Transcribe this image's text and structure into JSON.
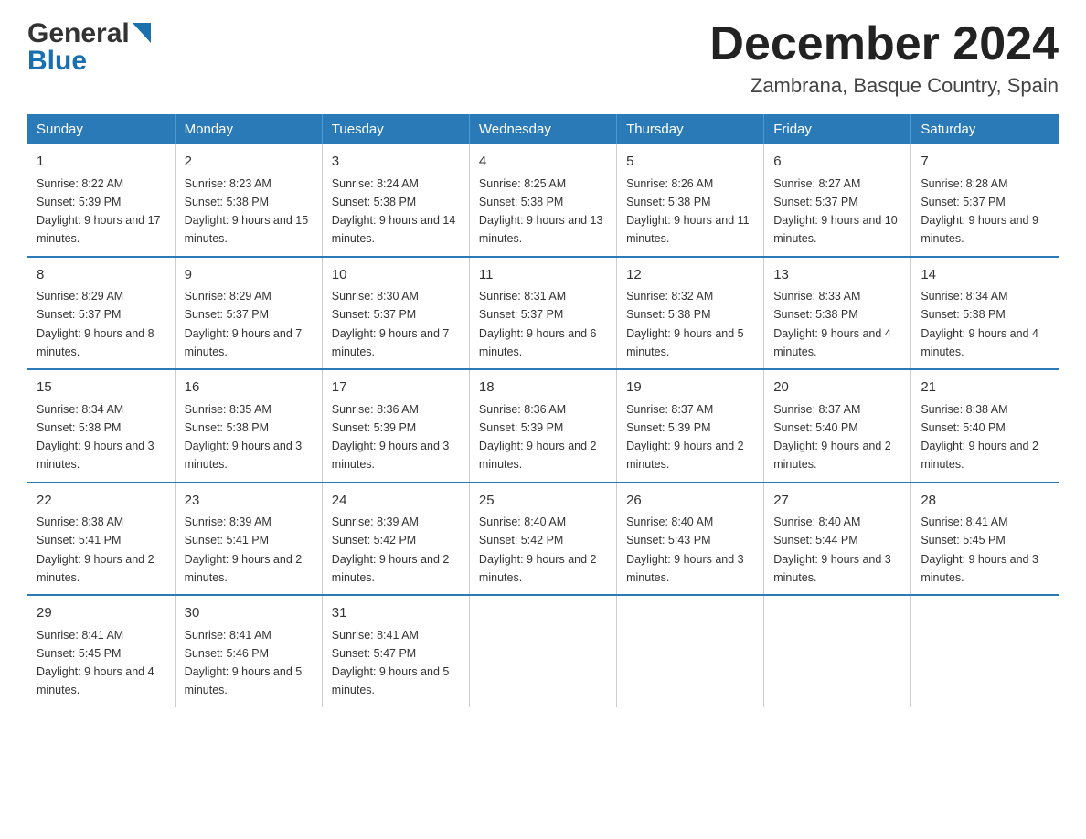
{
  "header": {
    "logo_general": "General",
    "logo_blue": "Blue",
    "title": "December 2024",
    "subtitle": "Zambrana, Basque Country, Spain"
  },
  "calendar": {
    "days_of_week": [
      "Sunday",
      "Monday",
      "Tuesday",
      "Wednesday",
      "Thursday",
      "Friday",
      "Saturday"
    ],
    "weeks": [
      [
        {
          "day": "1",
          "sunrise": "8:22 AM",
          "sunset": "5:39 PM",
          "daylight": "9 hours and 17 minutes."
        },
        {
          "day": "2",
          "sunrise": "8:23 AM",
          "sunset": "5:38 PM",
          "daylight": "9 hours and 15 minutes."
        },
        {
          "day": "3",
          "sunrise": "8:24 AM",
          "sunset": "5:38 PM",
          "daylight": "9 hours and 14 minutes."
        },
        {
          "day": "4",
          "sunrise": "8:25 AM",
          "sunset": "5:38 PM",
          "daylight": "9 hours and 13 minutes."
        },
        {
          "day": "5",
          "sunrise": "8:26 AM",
          "sunset": "5:38 PM",
          "daylight": "9 hours and 11 minutes."
        },
        {
          "day": "6",
          "sunrise": "8:27 AM",
          "sunset": "5:37 PM",
          "daylight": "9 hours and 10 minutes."
        },
        {
          "day": "7",
          "sunrise": "8:28 AM",
          "sunset": "5:37 PM",
          "daylight": "9 hours and 9 minutes."
        }
      ],
      [
        {
          "day": "8",
          "sunrise": "8:29 AM",
          "sunset": "5:37 PM",
          "daylight": "9 hours and 8 minutes."
        },
        {
          "day": "9",
          "sunrise": "8:29 AM",
          "sunset": "5:37 PM",
          "daylight": "9 hours and 7 minutes."
        },
        {
          "day": "10",
          "sunrise": "8:30 AM",
          "sunset": "5:37 PM",
          "daylight": "9 hours and 7 minutes."
        },
        {
          "day": "11",
          "sunrise": "8:31 AM",
          "sunset": "5:37 PM",
          "daylight": "9 hours and 6 minutes."
        },
        {
          "day": "12",
          "sunrise": "8:32 AM",
          "sunset": "5:38 PM",
          "daylight": "9 hours and 5 minutes."
        },
        {
          "day": "13",
          "sunrise": "8:33 AM",
          "sunset": "5:38 PM",
          "daylight": "9 hours and 4 minutes."
        },
        {
          "day": "14",
          "sunrise": "8:34 AM",
          "sunset": "5:38 PM",
          "daylight": "9 hours and 4 minutes."
        }
      ],
      [
        {
          "day": "15",
          "sunrise": "8:34 AM",
          "sunset": "5:38 PM",
          "daylight": "9 hours and 3 minutes."
        },
        {
          "day": "16",
          "sunrise": "8:35 AM",
          "sunset": "5:38 PM",
          "daylight": "9 hours and 3 minutes."
        },
        {
          "day": "17",
          "sunrise": "8:36 AM",
          "sunset": "5:39 PM",
          "daylight": "9 hours and 3 minutes."
        },
        {
          "day": "18",
          "sunrise": "8:36 AM",
          "sunset": "5:39 PM",
          "daylight": "9 hours and 2 minutes."
        },
        {
          "day": "19",
          "sunrise": "8:37 AM",
          "sunset": "5:39 PM",
          "daylight": "9 hours and 2 minutes."
        },
        {
          "day": "20",
          "sunrise": "8:37 AM",
          "sunset": "5:40 PM",
          "daylight": "9 hours and 2 minutes."
        },
        {
          "day": "21",
          "sunrise": "8:38 AM",
          "sunset": "5:40 PM",
          "daylight": "9 hours and 2 minutes."
        }
      ],
      [
        {
          "day": "22",
          "sunrise": "8:38 AM",
          "sunset": "5:41 PM",
          "daylight": "9 hours and 2 minutes."
        },
        {
          "day": "23",
          "sunrise": "8:39 AM",
          "sunset": "5:41 PM",
          "daylight": "9 hours and 2 minutes."
        },
        {
          "day": "24",
          "sunrise": "8:39 AM",
          "sunset": "5:42 PM",
          "daylight": "9 hours and 2 minutes."
        },
        {
          "day": "25",
          "sunrise": "8:40 AM",
          "sunset": "5:42 PM",
          "daylight": "9 hours and 2 minutes."
        },
        {
          "day": "26",
          "sunrise": "8:40 AM",
          "sunset": "5:43 PM",
          "daylight": "9 hours and 3 minutes."
        },
        {
          "day": "27",
          "sunrise": "8:40 AM",
          "sunset": "5:44 PM",
          "daylight": "9 hours and 3 minutes."
        },
        {
          "day": "28",
          "sunrise": "8:41 AM",
          "sunset": "5:45 PM",
          "daylight": "9 hours and 3 minutes."
        }
      ],
      [
        {
          "day": "29",
          "sunrise": "8:41 AM",
          "sunset": "5:45 PM",
          "daylight": "9 hours and 4 minutes."
        },
        {
          "day": "30",
          "sunrise": "8:41 AM",
          "sunset": "5:46 PM",
          "daylight": "9 hours and 5 minutes."
        },
        {
          "day": "31",
          "sunrise": "8:41 AM",
          "sunset": "5:47 PM",
          "daylight": "9 hours and 5 minutes."
        },
        null,
        null,
        null,
        null
      ]
    ]
  }
}
